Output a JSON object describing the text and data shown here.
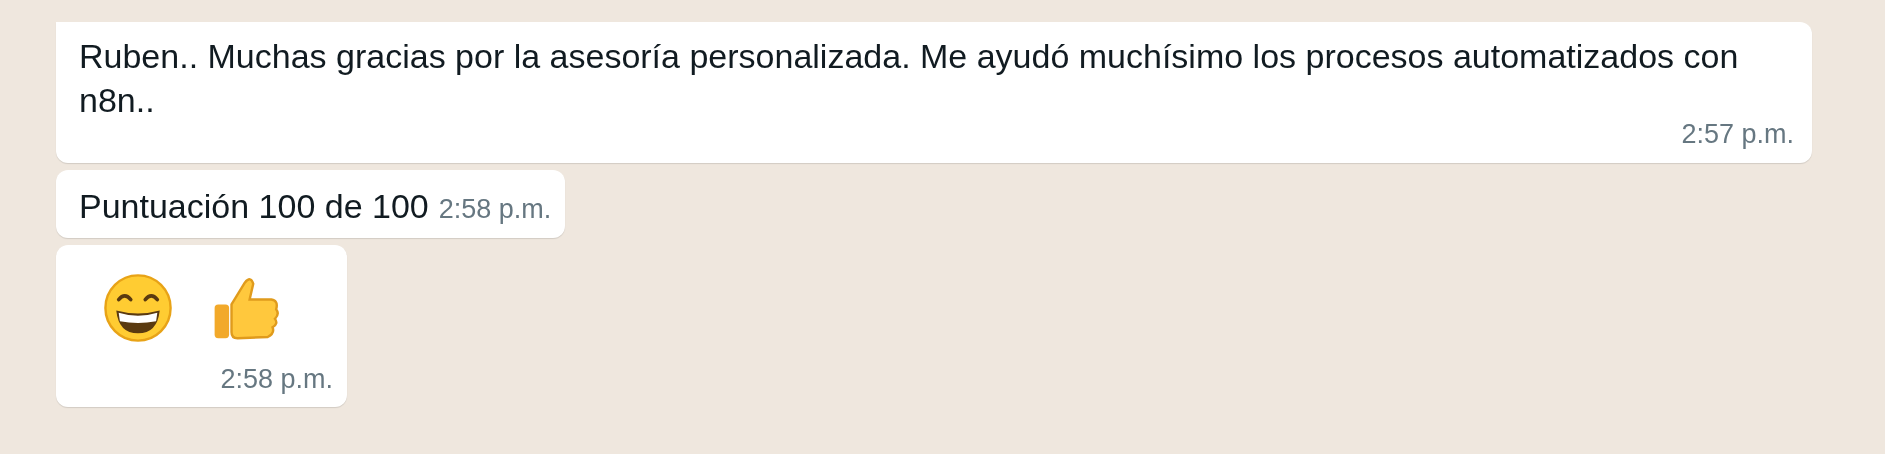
{
  "messages": [
    {
      "kind": "text",
      "text": "Ruben.. Muchas gracias por la asesoría personalizada. Me ayudó muchísimo los procesos automatizados con n8n..",
      "time": "2:57 p.m.",
      "first": true
    },
    {
      "kind": "text",
      "text": "Puntuación 100 de 100",
      "time": "2:58 p.m.",
      "first": false
    },
    {
      "kind": "emoji",
      "time": "2:58 p.m.",
      "first": false
    }
  ]
}
